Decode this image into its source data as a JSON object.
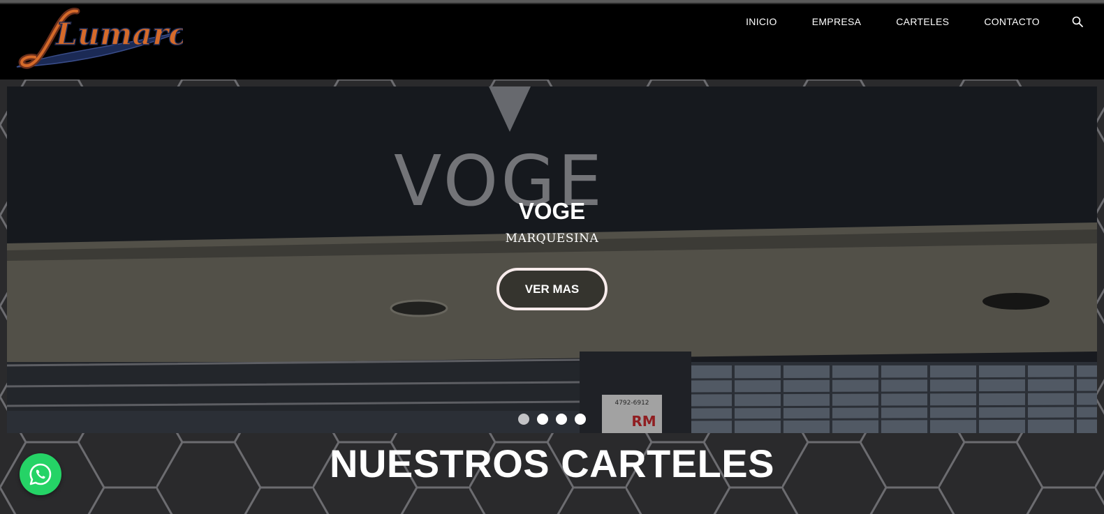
{
  "logo": {
    "alt": "Lumarc"
  },
  "nav": {
    "items": [
      "INICIO",
      "EMPRESA",
      "CARTELES",
      "CONTACTO"
    ],
    "search_icon": "search-icon"
  },
  "slider": {
    "title": "VOGE",
    "subtitle": "MARQUESINA",
    "button_label": "VER MAS",
    "photo_sign_text": "VOGE",
    "photo_phone": "4792-6912",
    "photo_badge": "RM",
    "slide_count": 4,
    "active_slide": 1
  },
  "section": {
    "title": "NUESTROS CARTELES"
  },
  "whatsapp": {
    "icon": "whatsapp-icon",
    "color": "#25d366"
  },
  "colors": {
    "header_bg": "#000000",
    "button_border": "#f7ebeb",
    "page_bg": "#1f1f21"
  }
}
